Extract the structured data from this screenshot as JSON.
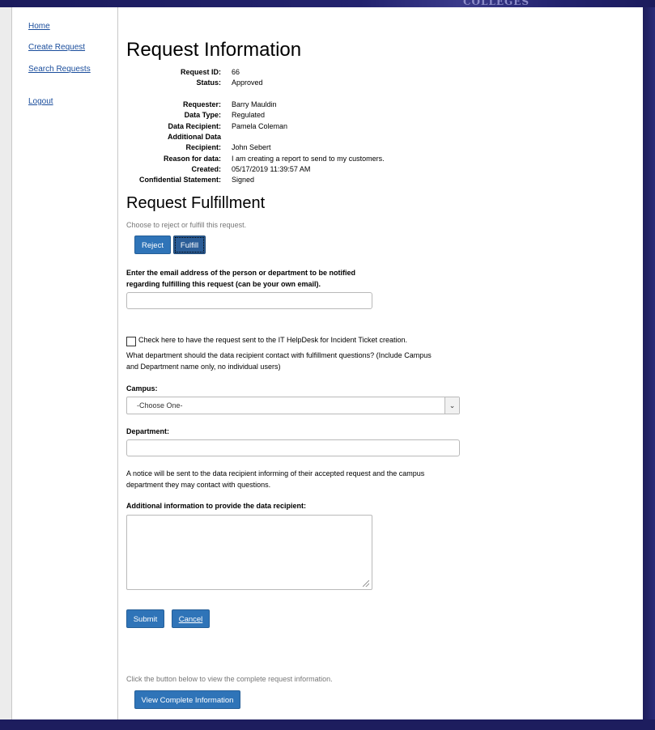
{
  "header": {
    "logo_text": "COLLEGES"
  },
  "nav": {
    "items": [
      {
        "label": "Home"
      },
      {
        "label": "Create Request"
      },
      {
        "label": "Search Requests"
      },
      {
        "label": "Logout"
      }
    ]
  },
  "request_info": {
    "title": "Request Information",
    "fields": [
      {
        "label": "Request ID:",
        "value": "66"
      },
      {
        "label": "Status:",
        "value": "Approved"
      },
      {
        "label": "Requester:",
        "value": "Barry Mauldin"
      },
      {
        "label": "Data Type:",
        "value": "Regulated"
      },
      {
        "label": "Data Recipient:",
        "value": "Pamela Coleman"
      },
      {
        "label": "Additional Data",
        "value": ""
      },
      {
        "label": "Recipient:",
        "value": "John Sebert"
      },
      {
        "label": "Reason for data:",
        "value": "I am creating a report to send to my customers."
      },
      {
        "label": "Created:",
        "value": "05/17/2019 11:39:57 AM"
      },
      {
        "label": "Confidential Statement:",
        "value": "Signed"
      }
    ]
  },
  "fulfillment": {
    "title": "Request Fulfillment",
    "instruction": "Choose to reject or fulfill this request.",
    "reject_label": "Reject",
    "fulfill_label": "Fulfill",
    "email_prompt_line1": "Enter the email address of the person or department to be notified",
    "email_prompt_line2": "regarding fulfilling this request (can be your own email).",
    "email_value": "",
    "helpdesk_checkbox_label": "Check here to have the request sent to the IT HelpDesk for Incident Ticket creation.",
    "dept_question_line1": "What department should the data recipient contact with fulfillment questions? (Include Campus",
    "dept_question_line2": "and Department name only, no individual users)",
    "campus_label": "Campus:",
    "campus_selected": "-Choose One-",
    "department_label": "Department:",
    "department_value": "",
    "notice_line1": "A notice will be sent to the data recipient informing of their accepted request and the campus",
    "notice_line2": "department they may contact with questions.",
    "additional_info_label": "Additional information to provide the data recipient:",
    "additional_info_value": "",
    "submit_label": "Submit",
    "cancel_label": "Cancel"
  },
  "footer": {
    "view_hint": "Click the button below to view the complete request information.",
    "view_button_label": "View Complete Information"
  }
}
